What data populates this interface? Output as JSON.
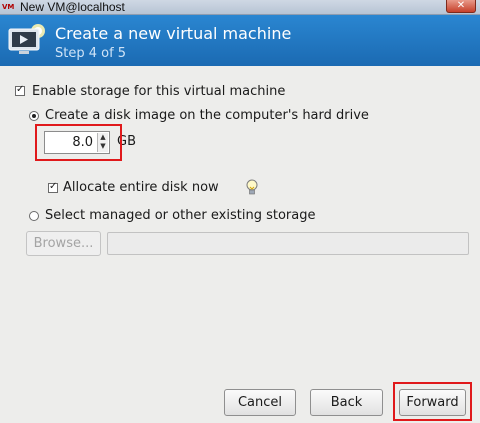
{
  "window": {
    "app_icon_text": "VM",
    "title": "New VM@localhost",
    "close_glyph": "✕"
  },
  "banner": {
    "heading": "Create a new virtual machine",
    "step": "Step 4 of 5",
    "icon": "monitor-play-icon"
  },
  "storage": {
    "enable_label": "Enable storage for this virtual machine",
    "enable_checked": true,
    "create_disk_label": "Create a disk image on the computer's hard drive",
    "create_disk_selected": true,
    "disk_size_value": "8.0",
    "disk_size_unit": "GB",
    "allocate_label": "Allocate entire disk now",
    "allocate_checked": true,
    "hint_icon": "lightbulb-icon",
    "managed_label": "Select managed or other existing storage",
    "managed_selected": false,
    "browse_label": "Browse...",
    "path_value": ""
  },
  "buttons": {
    "cancel": "Cancel",
    "back": "Back",
    "forward": "Forward"
  },
  "colors": {
    "banner": "#1f74bf",
    "highlight_box": "#e0191b"
  }
}
